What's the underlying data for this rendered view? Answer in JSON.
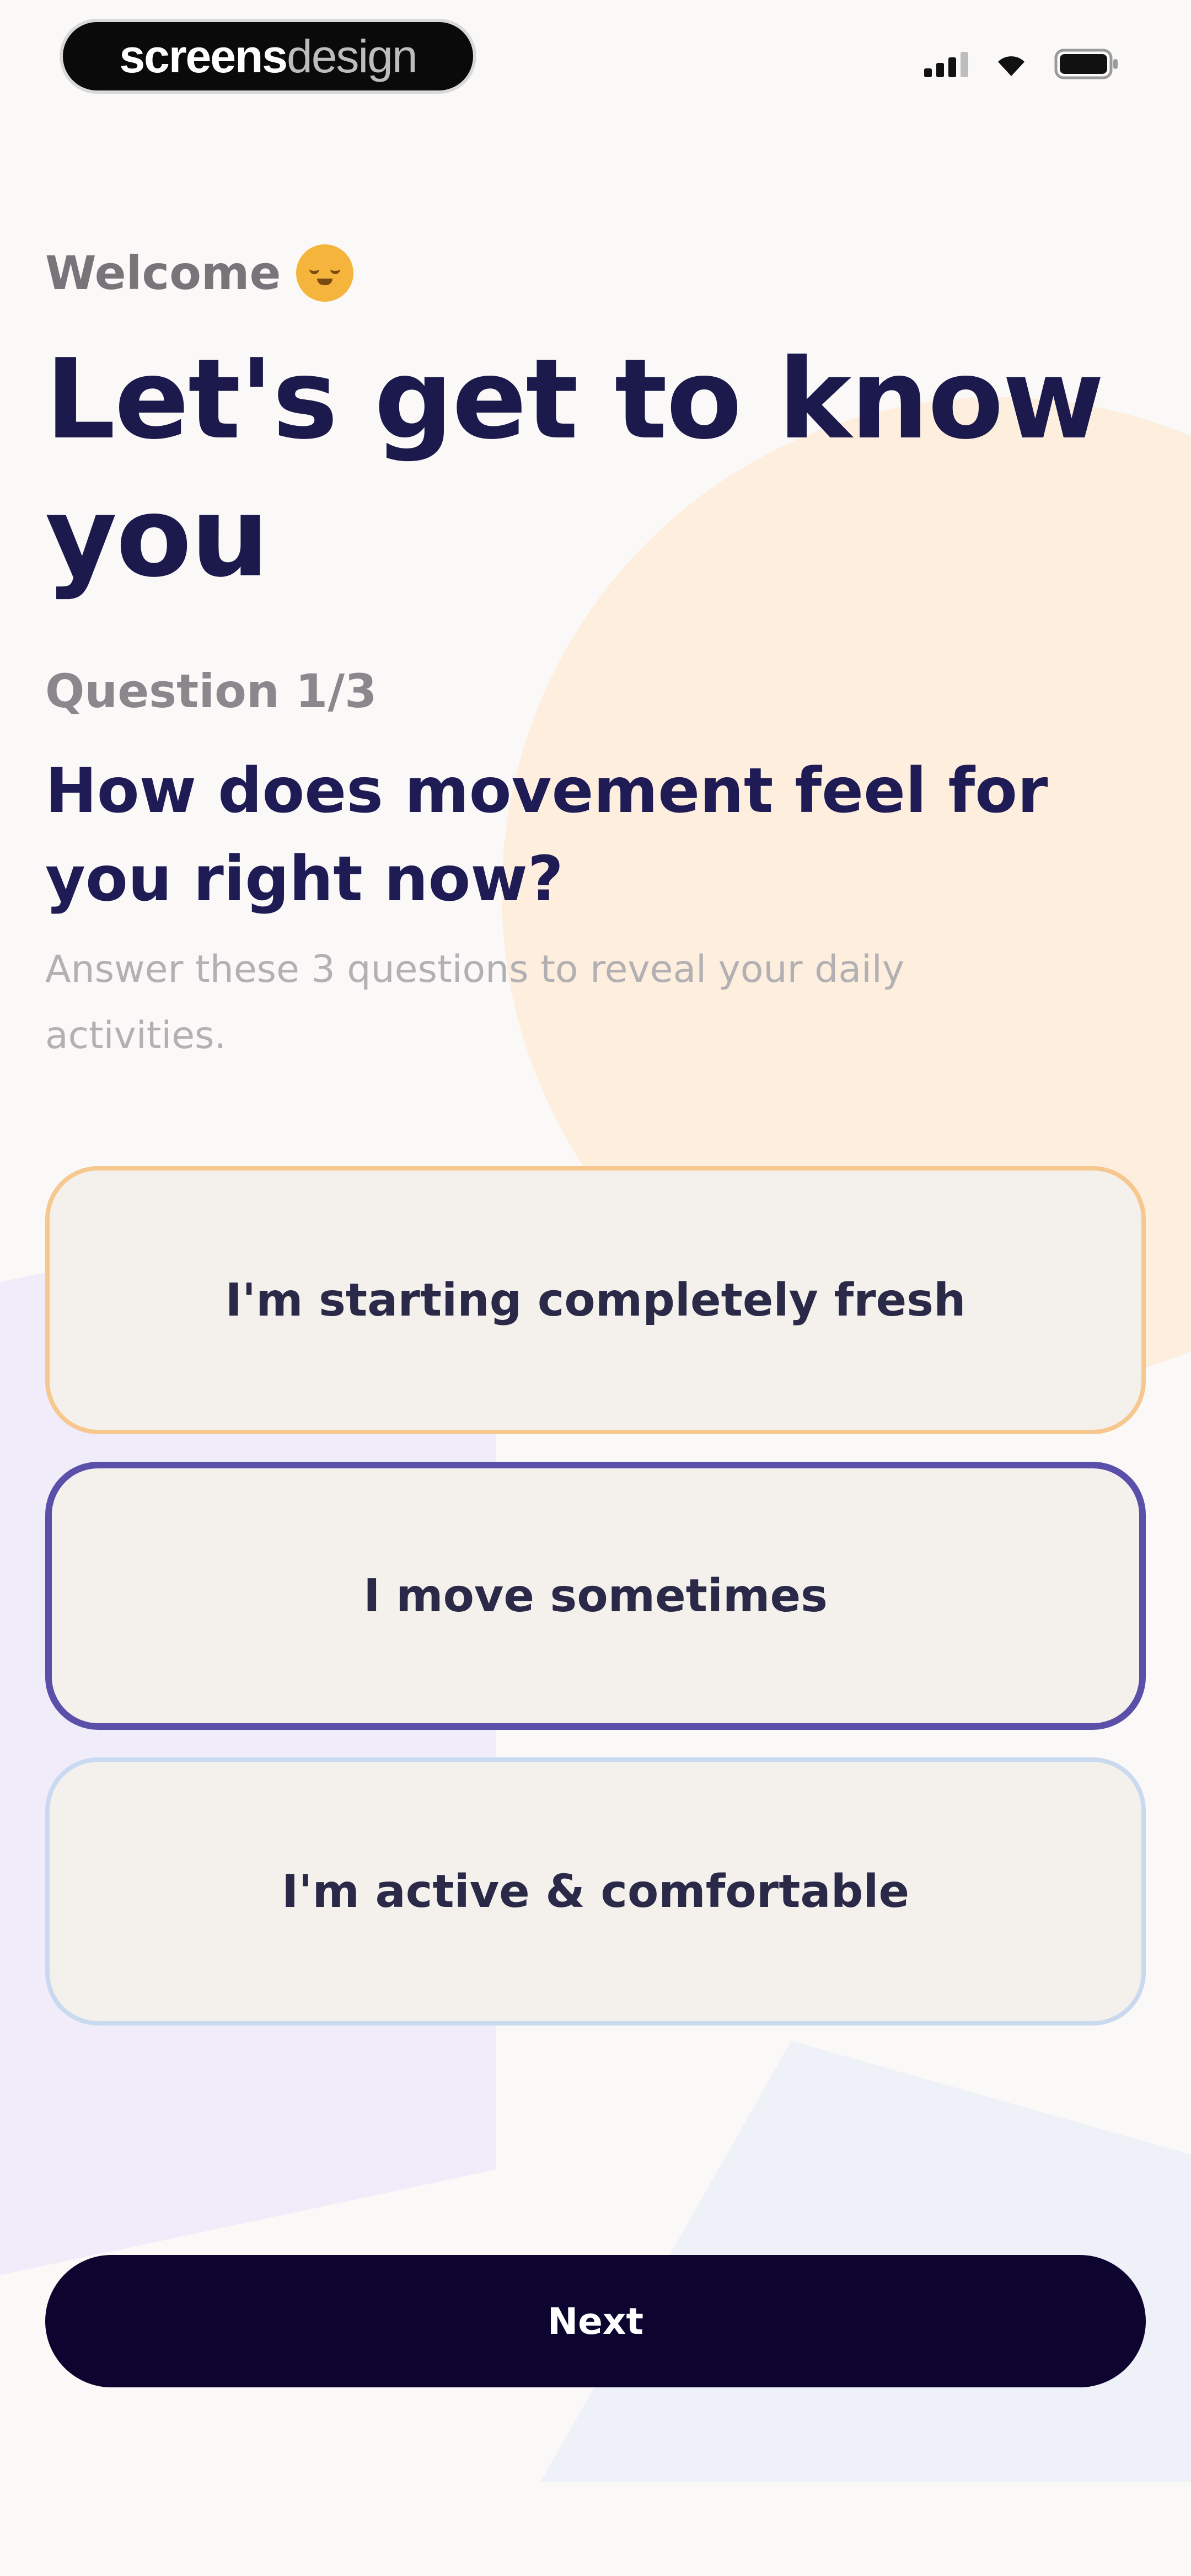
{
  "status_bar": {
    "brand_bold": "screens",
    "brand_light": "design"
  },
  "welcome": "Welcome",
  "headline_line1": "Let's get to know",
  "headline_line2": "you",
  "question_number": "Question 1/3",
  "question": "How does movement feel for you right now?",
  "helper_text": "Answer these 3 questions to reveal your daily activities.",
  "options": [
    {
      "label": "I'm starting completely fresh",
      "border_color": "#f6c78e"
    },
    {
      "label": "I move sometimes",
      "border_color": "#5a4fa9",
      "selected": true
    },
    {
      "label": "I'm active & comfortable",
      "border_color": "#c9d9ef"
    }
  ],
  "next_label": "Next",
  "colors": {
    "heading": "#1c1a4c",
    "primary_button": "#0d0530",
    "accent_peach": "#fdeedd"
  }
}
